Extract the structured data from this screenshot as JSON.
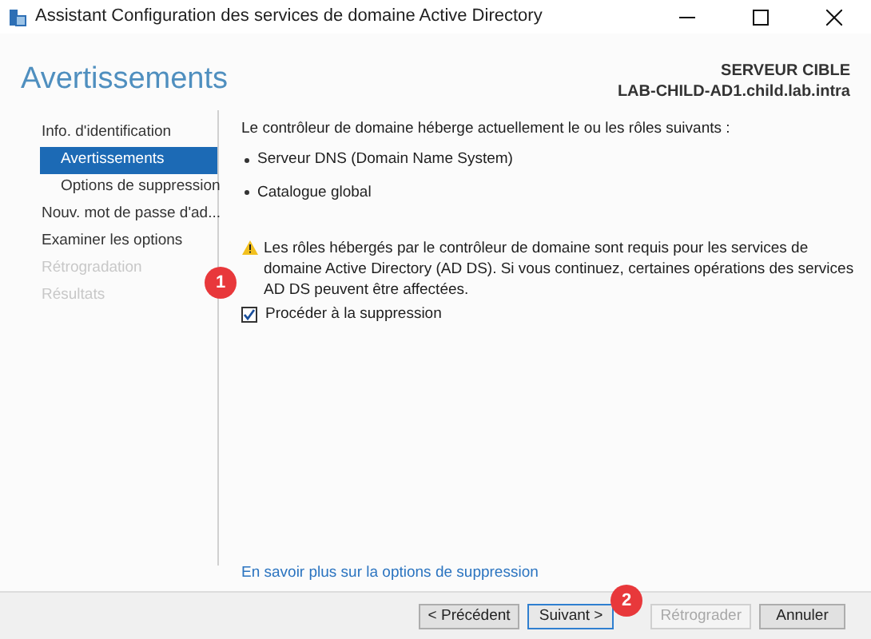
{
  "window": {
    "title": "Assistant Configuration des services de domaine Active Directory"
  },
  "header": {
    "title": "Avertissements",
    "target_label": "SERVEUR CIBLE",
    "target_name": "LAB-CHILD-AD1.child.lab.intra"
  },
  "nav": [
    {
      "label": "Info. d'identification",
      "selected": false,
      "disabled": false,
      "children": [
        {
          "label": "Avertissements",
          "selected": true,
          "disabled": false
        },
        {
          "label": "Options de suppression",
          "selected": false,
          "disabled": false
        }
      ]
    },
    {
      "label": "Nouv. mot de passe d'ad...",
      "selected": false,
      "disabled": false
    },
    {
      "label": "Examiner les options",
      "selected": false,
      "disabled": false
    },
    {
      "label": "Rétrogradation",
      "selected": false,
      "disabled": true
    },
    {
      "label": "Résultats",
      "selected": false,
      "disabled": true
    }
  ],
  "content": {
    "intro": "Le contrôleur de domaine héberge actuellement le ou les rôles suivants :",
    "roles": [
      "Serveur DNS (Domain Name System)",
      "Catalogue global"
    ],
    "warning": "Les rôles hébergés par le contrôleur de domaine sont requis pour les services de domaine Active Directory (AD DS). Si vous continuez, certaines opérations des services AD DS peuvent être affectées.",
    "checkbox": {
      "label": "Procéder à la suppression",
      "checked": true
    },
    "link": "En savoir plus sur la options de suppression"
  },
  "buttons": [
    {
      "label": "< Précédent",
      "disabled": false,
      "default": false
    },
    {
      "label": "Suivant >",
      "disabled": false,
      "default": true
    },
    {
      "label": "Rétrograder",
      "disabled": true,
      "default": false
    },
    {
      "label": "Annuler",
      "disabled": false,
      "default": false
    }
  ],
  "annotations": [
    "1",
    "2"
  ]
}
